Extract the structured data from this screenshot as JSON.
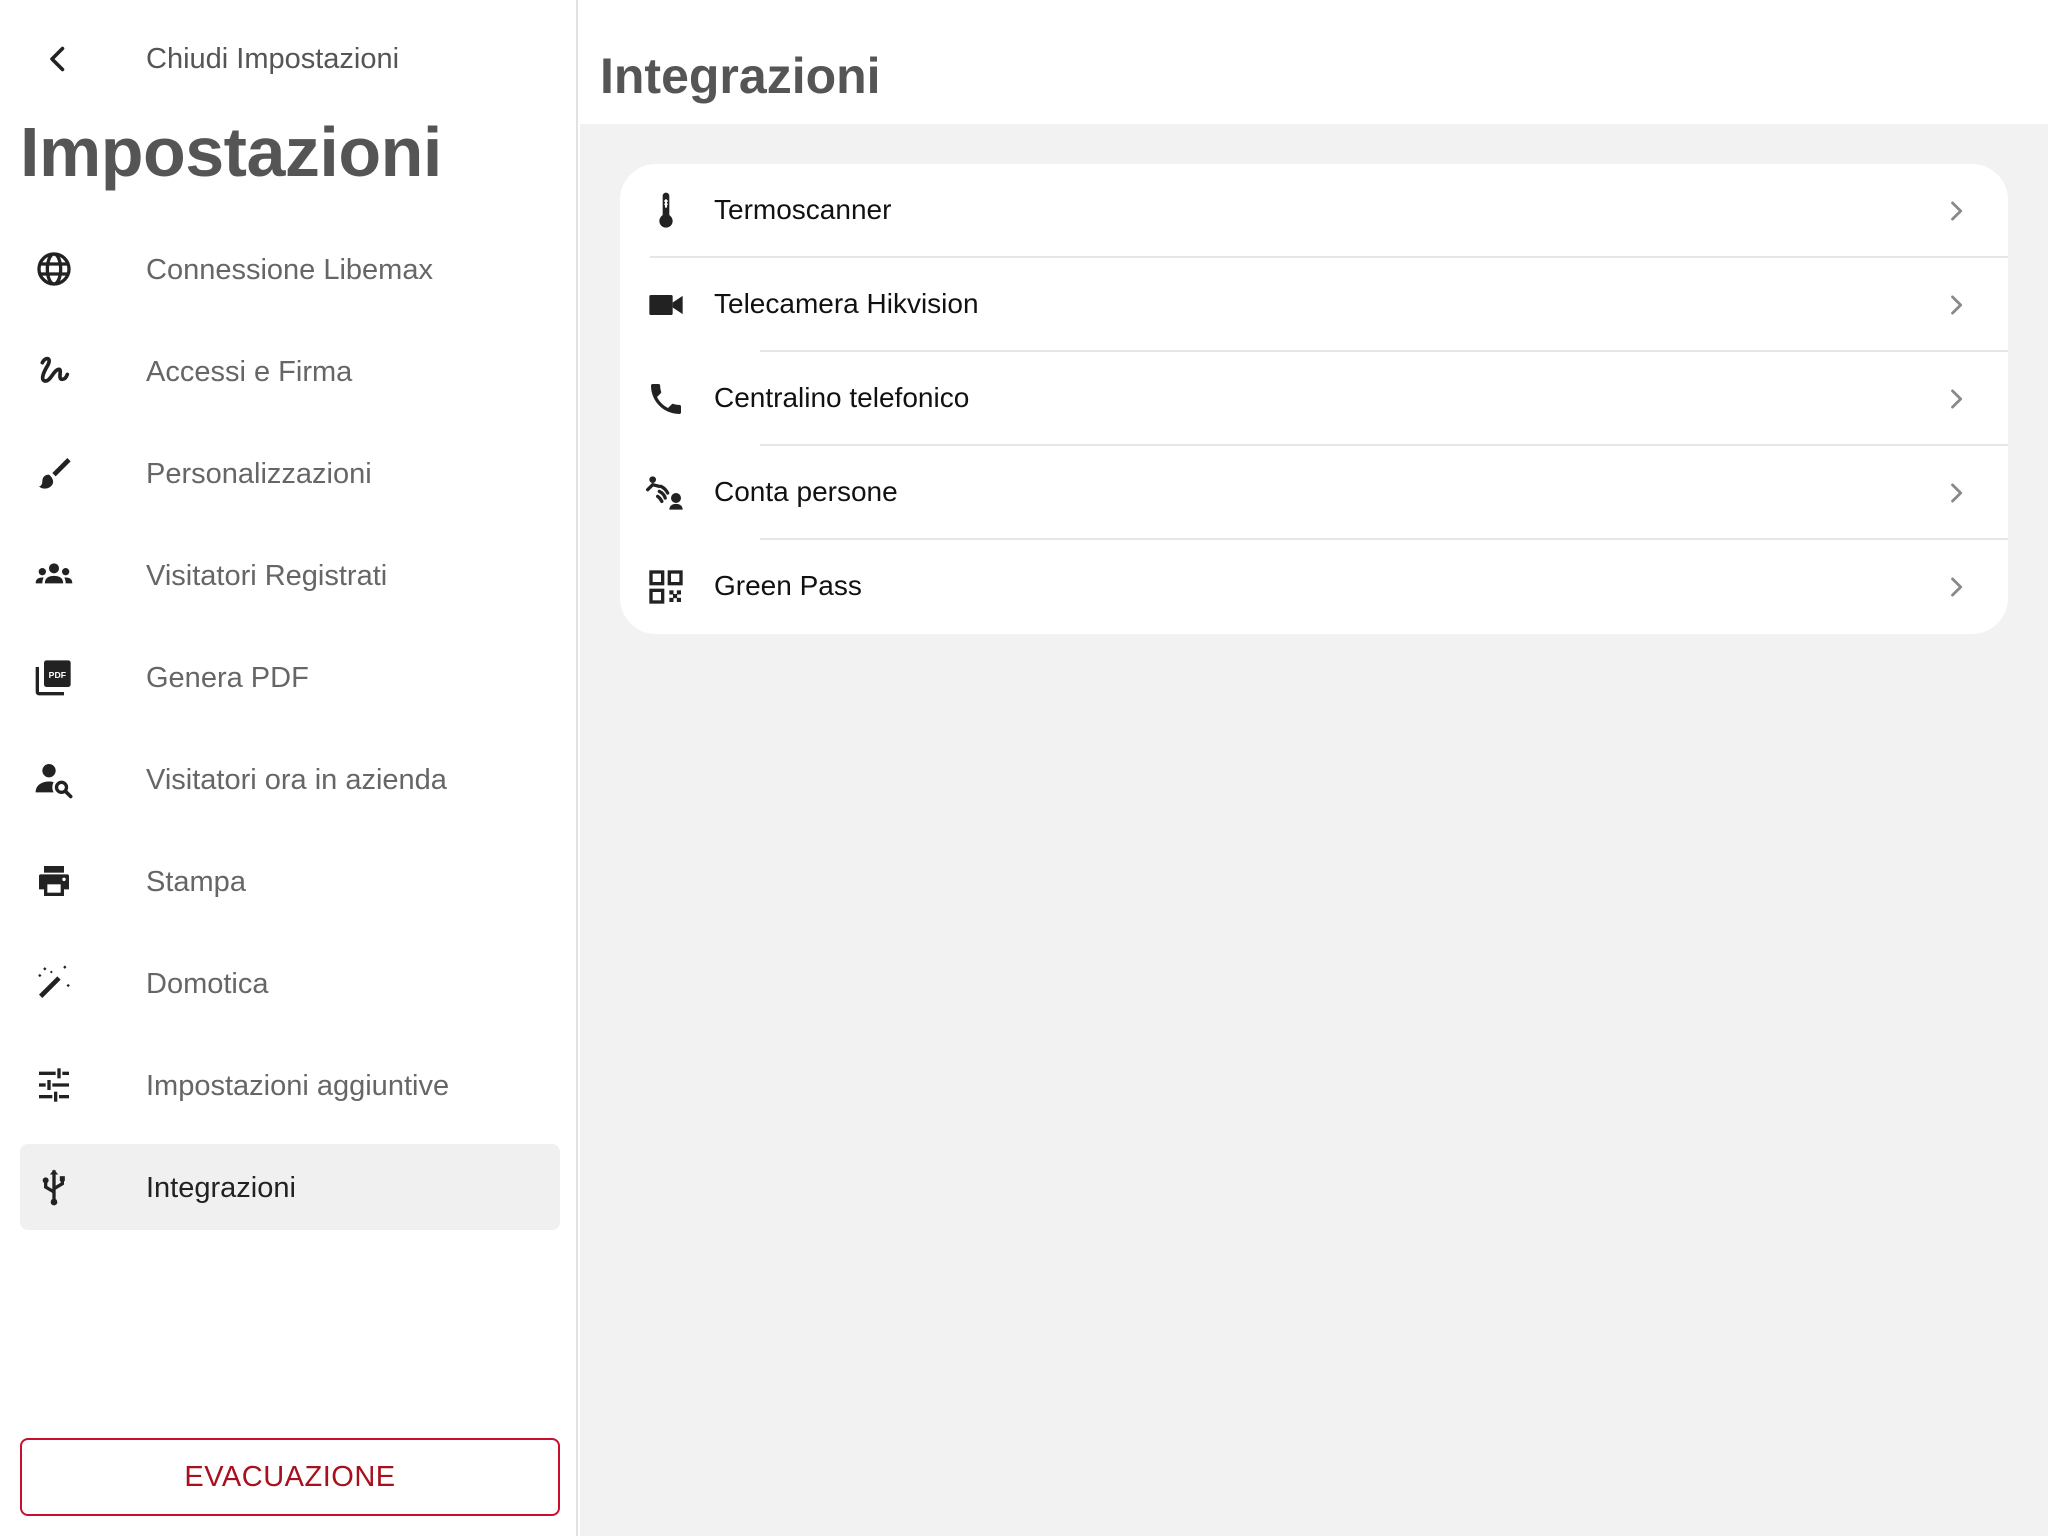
{
  "sidebar": {
    "close_label": "Chiudi Impostazioni",
    "title": "Impostazioni",
    "items": [
      {
        "label": "Connessione Libemax",
        "icon": "globe-icon"
      },
      {
        "label": "Accessi e Firma",
        "icon": "signature-icon"
      },
      {
        "label": "Personalizzazioni",
        "icon": "brush-icon"
      },
      {
        "label": "Visitatori Registrati",
        "icon": "groups-icon"
      },
      {
        "label": "Genera PDF",
        "icon": "pdf-icon"
      },
      {
        "label": "Visitatori ora in azienda",
        "icon": "person-search-icon"
      },
      {
        "label": "Stampa",
        "icon": "printer-icon"
      },
      {
        "label": "Domotica",
        "icon": "magic-wand-icon"
      },
      {
        "label": "Impostazioni aggiuntive",
        "icon": "tune-icon"
      },
      {
        "label": "Integrazioni",
        "icon": "usb-icon",
        "active": true
      }
    ],
    "evacuation_label": "EVACUAZIONE"
  },
  "main": {
    "title": "Integrazioni",
    "items": [
      {
        "label": "Termoscanner",
        "icon": "thermometer-icon"
      },
      {
        "label": "Telecamera Hikvision",
        "icon": "videocam-icon"
      },
      {
        "label": "Centralino telefonico",
        "icon": "phone-icon"
      },
      {
        "label": "Conta persone",
        "icon": "people-counter-icon"
      },
      {
        "label": "Green Pass",
        "icon": "qr-code-icon"
      }
    ]
  },
  "colors": {
    "accent_red": "#c8102e",
    "active_item_bg": "#f0f0f0",
    "main_bg": "#f2f2f2",
    "icon_color": "#222222"
  }
}
